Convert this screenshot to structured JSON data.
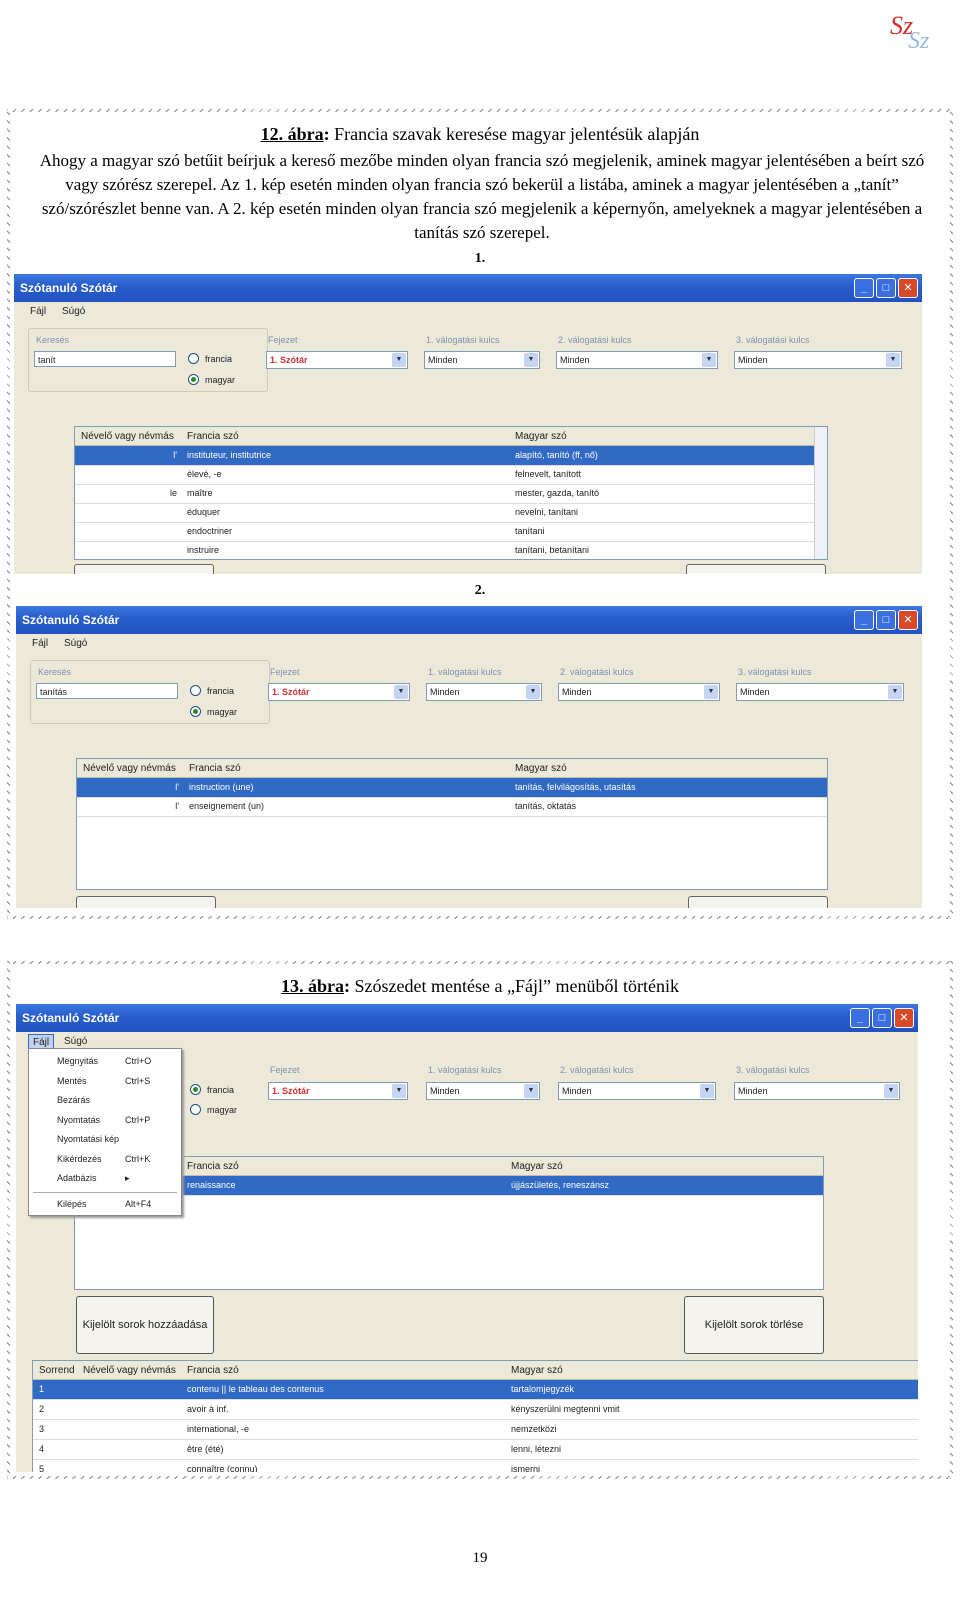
{
  "logo": {
    "text": "SzSz"
  },
  "fig12": {
    "caption_num": "12. ábra",
    "caption_colon": ":",
    "caption_text": " Francia szavak keresése magyar jelentésük alapján",
    "paragraph": "Ahogy a magyar szó betűit beírjuk a kereső mezőbe minden olyan francia szó megjelenik, aminek magyar jelentésében a beírt szó vagy szórész szerepel. Az 1. kép esetén minden olyan francia szó bekerül a listába, aminek a magyar jelentésében a „tanít” szó/szórészlet benne van. A 2. kép esetén minden olyan francia szó megjelenik a képernyőn, amelyeknek a magyar jelentésében a tanítás szó szerepel.",
    "label1": "1.",
    "label2": "2."
  },
  "fig13": {
    "caption_num": "13. ábra",
    "caption_colon": ":",
    "caption_text": " Szószedet mentése a „Fájl” menüből történik"
  },
  "app": {
    "title": "Szótanuló Szótár",
    "menu_file": "Fájl",
    "menu_help": "Súgó",
    "search_label": "Keresés",
    "chapter_label": "Fejezet",
    "key1_label": "1. válogatási kulcs",
    "key2_label": "2. válogatási kulcs",
    "key3_label": "3. válogatási kulcs",
    "radio_french": "francia",
    "radio_hungarian": "magyar",
    "chapter_value": "1. Szótár",
    "key_value": "Minden",
    "col_article": "Névelő vagy névmás",
    "col_french": "Francia szó",
    "col_hungarian": "Magyar szó",
    "col_order": "Sorrend"
  },
  "screen1": {
    "search_value": "tanít",
    "rows": [
      {
        "article": "l'",
        "french": "instituteur, institutrice",
        "hungarian": "alapító, tanító (ff, nő)"
      },
      {
        "article": "",
        "french": "élevé, -e",
        "hungarian": "felnevelt, tanított"
      },
      {
        "article": "le",
        "french": "maître",
        "hungarian": "mester, gazda, tanító"
      },
      {
        "article": "",
        "french": "éduquer",
        "hungarian": "nevelni, tanítani"
      },
      {
        "article": "",
        "french": "endoctriner",
        "hungarian": "tanítani"
      },
      {
        "article": "",
        "french": "instruire",
        "hungarian": "tanítani, betanítani"
      }
    ]
  },
  "screen2": {
    "search_value": "tanítás",
    "rows": [
      {
        "article": "l'",
        "french": "instruction (une)",
        "hungarian": "tanítás, felvilágosítás, utasítás"
      },
      {
        "article": "l'",
        "french": "enseignement (un)",
        "hungarian": "tanítás, oktatás"
      }
    ]
  },
  "screen3": {
    "menu_items": [
      {
        "label": "Megnyitás",
        "shortcut": "Ctrl+O"
      },
      {
        "label": "Mentés",
        "shortcut": "Ctrl+S"
      },
      {
        "label": "Bezárás",
        "shortcut": ""
      },
      {
        "label": "Nyomtatás",
        "shortcut": "Ctrl+P"
      },
      {
        "label": "Nyomtatási kép",
        "shortcut": ""
      },
      {
        "label": "Kikérdezés",
        "shortcut": "Ctrl+K"
      },
      {
        "label": "Adatbázis",
        "shortcut": "▸"
      },
      {
        "label": "Kilépés",
        "shortcut": "Alt+F4"
      }
    ],
    "upper_row": {
      "french": "renaissance",
      "hungarian": "újjászületés, reneszánsz"
    },
    "add_button": "Kijelölt sorok hozzáadása",
    "delete_button": "Kijelölt sorok törlése",
    "lower_rows": [
      {
        "order": "1",
        "french": "contenu || le tableau des contenus",
        "hungarian": "tartalomjegyzék"
      },
      {
        "order": "2",
        "french": "avoir à inf.",
        "hungarian": "kényszerülni megtenni vmit"
      },
      {
        "order": "3",
        "french": "international, -e",
        "hungarian": "nemzetközi"
      },
      {
        "order": "4",
        "french": "être (été)",
        "hungarian": "lenni, létezni"
      },
      {
        "order": "5",
        "french": "connaître (connu)",
        "hungarian": "ismerni"
      }
    ]
  },
  "page_number": "19"
}
